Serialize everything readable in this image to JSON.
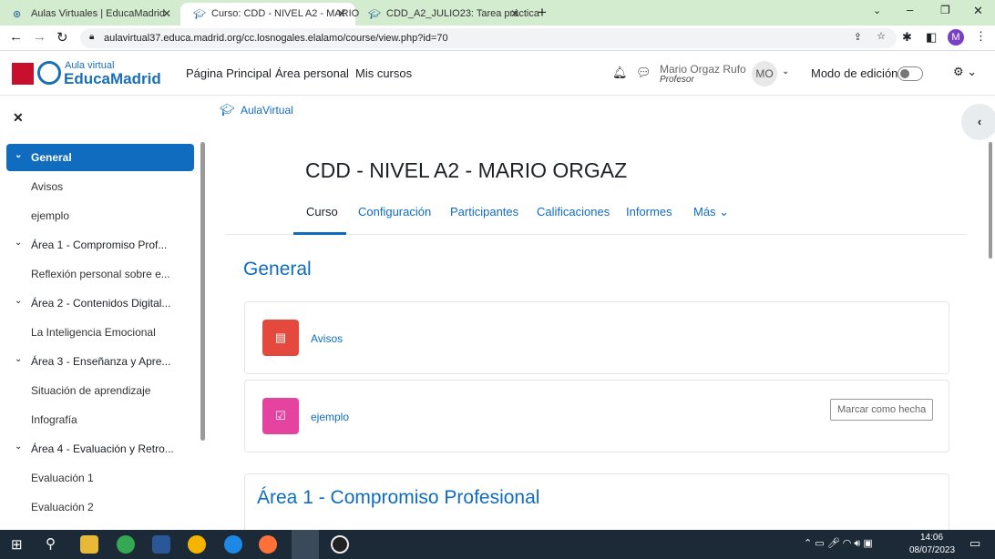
{
  "browser": {
    "tabs": [
      {
        "title": "Aulas Virtuales | EducaMadrid"
      },
      {
        "title": "Curso: CDD - NIVEL A2 - MARIO"
      },
      {
        "title": "CDD_A2_JULIO23: Tarea práctica"
      }
    ],
    "url": "aulavirtual37.educa.madrid.org/cc.losnogales.elalamo/course/view.php?id=70",
    "profile": "M"
  },
  "nav": {
    "logo_small": "Aula virtual",
    "logo_big": "EducaMadrid",
    "links": [
      "Página Principal",
      "Área personal",
      "Mis cursos"
    ],
    "user_name": "Mario Orgaz Rufo",
    "user_role": "Profesor",
    "avatar": "MO",
    "edit_mode": "Modo de edición",
    "edit_mode_on": false
  },
  "sidebar": {
    "items": [
      {
        "label": "General",
        "type": "head"
      },
      {
        "label": "Avisos",
        "type": "sub"
      },
      {
        "label": "ejemplo",
        "type": "sub"
      },
      {
        "label": "Área 1 - Compromiso Prof...",
        "type": "head"
      },
      {
        "label": "Reflexión personal sobre e...",
        "type": "sub"
      },
      {
        "label": "Área 2 - Contenidos Digital...",
        "type": "head"
      },
      {
        "label": "La Inteligencia Emocional",
        "type": "sub"
      },
      {
        "label": "Área 3 - Enseñanza y Apre...",
        "type": "head"
      },
      {
        "label": "Situación de aprendizaje",
        "type": "sub"
      },
      {
        "label": "Infografía",
        "type": "sub"
      },
      {
        "label": "Área 4 - Evaluación y Retro...",
        "type": "head"
      },
      {
        "label": "Evaluación 1",
        "type": "sub"
      },
      {
        "label": "Evaluación 2",
        "type": "sub"
      }
    ]
  },
  "main": {
    "breadcrumb": "AulaVirtual",
    "title": "CDD - NIVEL A2 - MARIO ORGAZ",
    "tabs": [
      "Curso",
      "Configuración",
      "Participantes",
      "Calificaciones",
      "Informes",
      "Más"
    ],
    "section1": "General",
    "activities": [
      {
        "name": "Avisos",
        "color": "#e5483c"
      },
      {
        "name": "ejemplo",
        "color": "#e4439f",
        "button": "Marcar como hecha"
      }
    ],
    "section2": "Área 1 - Compromiso Profesional"
  },
  "taskbar": {
    "time": "14:06",
    "date": "08/07/2023"
  }
}
